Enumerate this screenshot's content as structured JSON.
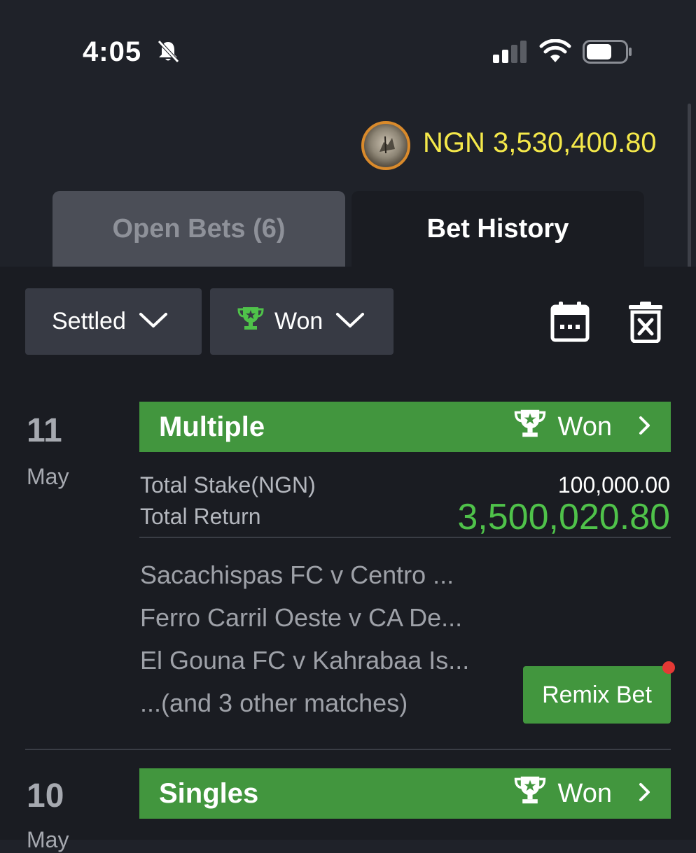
{
  "status_bar": {
    "time": "4:05"
  },
  "account": {
    "balance": "NGN 3,530,400.80"
  },
  "tabs": [
    {
      "label": "Open Bets (6)",
      "active": false
    },
    {
      "label": "Bet History",
      "active": true
    }
  ],
  "filters": {
    "settled_label": "Settled",
    "result_label": "Won"
  },
  "bets": [
    {
      "day": "11",
      "month": "May",
      "type": "Multiple",
      "status": "Won",
      "total_stake_label": "Total Stake(NGN)",
      "total_stake_value": "100,000.00",
      "total_return_label": "Total Return",
      "total_return_value": "3,500,020.80",
      "matches": [
        "Sacachispas FC v Centro ...",
        "Ferro Carril Oeste v CA De...",
        "El Gouna FC v Kahrabaa Is...",
        "...(and 3 other matches)"
      ],
      "remix_label": "Remix Bet"
    },
    {
      "day": "10",
      "month": "May",
      "type": "Singles",
      "status": "Won"
    }
  ],
  "colors": {
    "background": "#1f2229",
    "panel": "#1a1c22",
    "won_green": "#42963e",
    "return_green": "#4fc24a",
    "balance_yellow": "#f4e84a",
    "notification_red": "#e53935"
  },
  "icons": [
    "bell-off-icon",
    "signal-icon",
    "wifi-icon",
    "battery-icon",
    "trophy-icon",
    "chevron-down-icon",
    "calendar-icon",
    "clear-icon",
    "chevron-right-icon"
  ]
}
